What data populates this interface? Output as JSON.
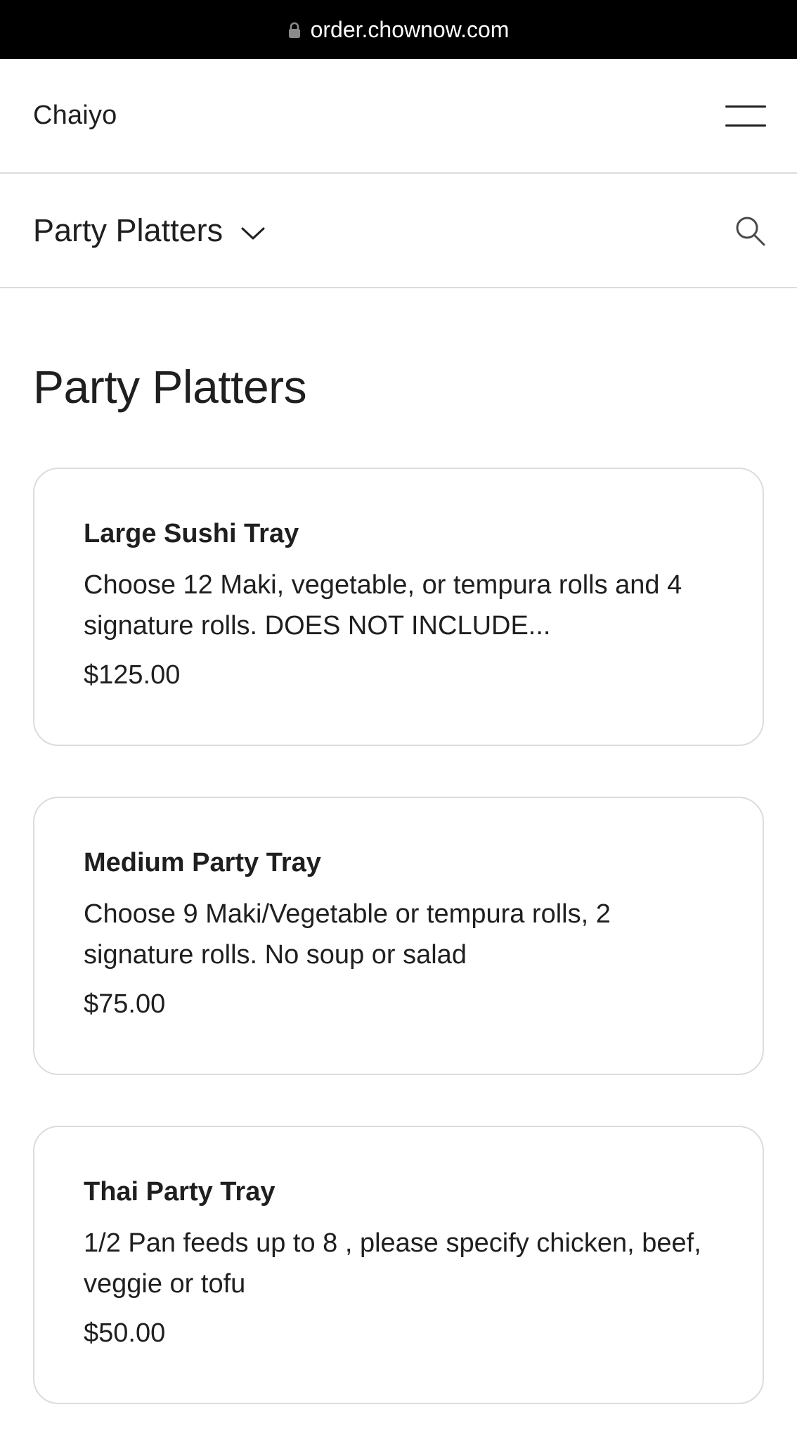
{
  "browser": {
    "url": "order.chownow.com"
  },
  "header": {
    "restaurant_name": "Chaiyo"
  },
  "category_bar": {
    "selected_category": "Party Platters"
  },
  "section": {
    "title": "Party Platters"
  },
  "menu_items": [
    {
      "name": "Large Sushi Tray",
      "description": "Choose 12 Maki, vegetable, or tempura rolls and 4 signature rolls. DOES NOT INCLUDE...",
      "price": "$125.00"
    },
    {
      "name": "Medium Party Tray",
      "description": "Choose 9 Maki/Vegetable or tempura rolls, 2 signature rolls. No soup or salad",
      "price": "$75.00"
    },
    {
      "name": "Thai Party Tray",
      "description": "1/2 Pan feeds up to 8 , please specify chicken, beef, veggie or tofu",
      "price": "$50.00"
    }
  ],
  "icons": {
    "lock": "lock-icon",
    "menu": "hamburger-menu-icon",
    "dropdown": "chevron-down-icon",
    "search": "search-icon"
  },
  "colors": {
    "text": "#1f1f1f",
    "divider": "#dcdcdc",
    "url_bar_bg": "#000000"
  }
}
